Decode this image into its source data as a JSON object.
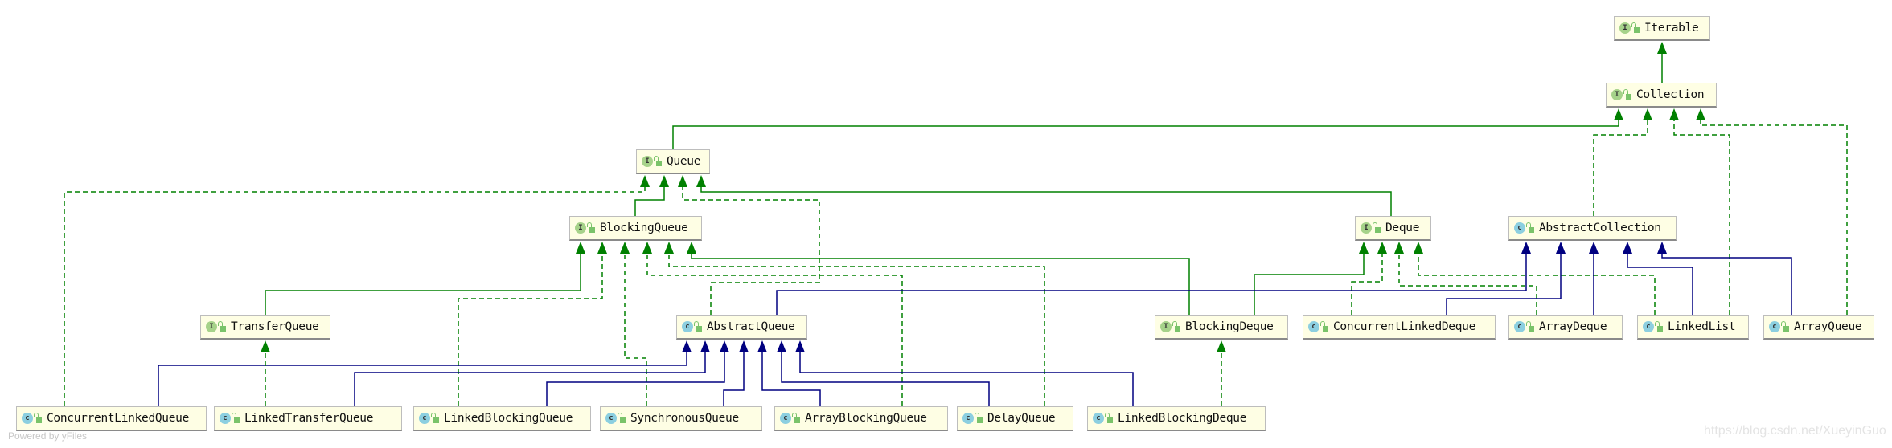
{
  "colors": {
    "inherits": "#008000",
    "implements": "#008000",
    "extends_class": "#000080",
    "node_bg": "#fefee4"
  },
  "nodes": [
    {
      "name": "Iterable",
      "kind": "interface",
      "icon": "I"
    },
    {
      "name": "Collection",
      "kind": "interface",
      "icon": "I"
    },
    {
      "name": "Queue",
      "kind": "interface",
      "icon": "I"
    },
    {
      "name": "BlockingQueue",
      "kind": "interface",
      "icon": "I"
    },
    {
      "name": "Deque",
      "kind": "interface",
      "icon": "I"
    },
    {
      "name": "AbstractCollection",
      "kind": "class",
      "icon": "c"
    },
    {
      "name": "TransferQueue",
      "kind": "interface",
      "icon": "I"
    },
    {
      "name": "AbstractQueue",
      "kind": "class",
      "icon": "c"
    },
    {
      "name": "BlockingDeque",
      "kind": "interface",
      "icon": "I"
    },
    {
      "name": "ConcurrentLinkedDeque",
      "kind": "class",
      "icon": "c"
    },
    {
      "name": "ArrayDeque",
      "kind": "class",
      "icon": "c"
    },
    {
      "name": "LinkedList",
      "kind": "class",
      "icon": "c"
    },
    {
      "name": "ArrayQueue",
      "kind": "class",
      "icon": "c"
    },
    {
      "name": "ConcurrentLinkedQueue",
      "kind": "class",
      "icon": "c"
    },
    {
      "name": "LinkedTransferQueue",
      "kind": "class",
      "icon": "c"
    },
    {
      "name": "LinkedBlockingQueue",
      "kind": "class",
      "icon": "c"
    },
    {
      "name": "SynchronousQueue",
      "kind": "class",
      "icon": "c"
    },
    {
      "name": "ArrayBlockingQueue",
      "kind": "class",
      "icon": "c"
    },
    {
      "name": "DelayQueue",
      "kind": "class",
      "icon": "c"
    },
    {
      "name": "LinkedBlockingDeque",
      "kind": "class",
      "icon": "c"
    }
  ],
  "edges": [
    {
      "from": "Collection",
      "to": "Iterable",
      "type": "inherits"
    },
    {
      "from": "Queue",
      "to": "Collection",
      "type": "inherits"
    },
    {
      "from": "AbstractCollection",
      "to": "Collection",
      "type": "implements"
    },
    {
      "from": "LinkedList",
      "to": "Collection",
      "type": "implements"
    },
    {
      "from": "ArrayQueue",
      "to": "Collection",
      "type": "implements"
    },
    {
      "from": "ConcurrentLinkedQueue",
      "to": "Queue",
      "type": "implements"
    },
    {
      "from": "BlockingQueue",
      "to": "Queue",
      "type": "inherits"
    },
    {
      "from": "AbstractQueue",
      "to": "Queue",
      "type": "implements"
    },
    {
      "from": "Deque",
      "to": "Queue",
      "type": "inherits"
    },
    {
      "from": "TransferQueue",
      "to": "BlockingQueue",
      "type": "inherits"
    },
    {
      "from": "LinkedBlockingQueue",
      "to": "BlockingQueue",
      "type": "implements"
    },
    {
      "from": "SynchronousQueue",
      "to": "BlockingQueue",
      "type": "implements"
    },
    {
      "from": "ArrayBlockingQueue",
      "to": "BlockingQueue",
      "type": "implements"
    },
    {
      "from": "DelayQueue",
      "to": "BlockingQueue",
      "type": "implements"
    },
    {
      "from": "BlockingDeque",
      "to": "BlockingQueue",
      "type": "inherits"
    },
    {
      "from": "BlockingDeque",
      "to": "Deque",
      "type": "inherits"
    },
    {
      "from": "ConcurrentLinkedDeque",
      "to": "Deque",
      "type": "implements"
    },
    {
      "from": "ArrayDeque",
      "to": "Deque",
      "type": "implements"
    },
    {
      "from": "LinkedList",
      "to": "Deque",
      "type": "implements"
    },
    {
      "from": "AbstractQueue",
      "to": "AbstractCollection",
      "type": "extends_class"
    },
    {
      "from": "ConcurrentLinkedDeque",
      "to": "AbstractCollection",
      "type": "extends_class"
    },
    {
      "from": "ArrayDeque",
      "to": "AbstractCollection",
      "type": "extends_class"
    },
    {
      "from": "LinkedList",
      "to": "AbstractCollection",
      "type": "extends_class"
    },
    {
      "from": "ArrayQueue",
      "to": "AbstractCollection",
      "type": "extends_class"
    },
    {
      "from": "ConcurrentLinkedQueue",
      "to": "AbstractQueue",
      "type": "extends_class"
    },
    {
      "from": "LinkedTransferQueue",
      "to": "AbstractQueue",
      "type": "extends_class"
    },
    {
      "from": "LinkedBlockingQueue",
      "to": "AbstractQueue",
      "type": "extends_class"
    },
    {
      "from": "SynchronousQueue",
      "to": "AbstractQueue",
      "type": "extends_class"
    },
    {
      "from": "ArrayBlockingQueue",
      "to": "AbstractQueue",
      "type": "extends_class"
    },
    {
      "from": "DelayQueue",
      "to": "AbstractQueue",
      "type": "extends_class"
    },
    {
      "from": "LinkedBlockingDeque",
      "to": "AbstractQueue",
      "type": "extends_class"
    },
    {
      "from": "LinkedBlockingDeque",
      "to": "BlockingDeque",
      "type": "implements"
    },
    {
      "from": "LinkedTransferQueue",
      "to": "TransferQueue",
      "type": "implements"
    }
  ],
  "footer": "Powered by yFiles",
  "watermark": "https://blog.csdn.net/XueyinGuo"
}
